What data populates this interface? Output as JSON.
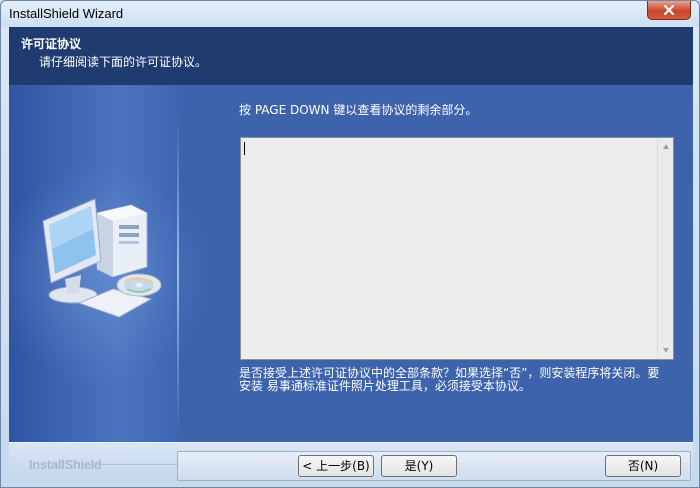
{
  "window": {
    "title": "InstallShield Wizard"
  },
  "header": {
    "title": "许可证协议",
    "subtitle": "请仔细阅读下面的许可证协议。"
  },
  "content": {
    "instruction": "按 PAGE DOWN 键以查看协议的剩余部分。",
    "license_text": "",
    "question_line1": "是否接受上述许可证协议中的全部条款？如果选择“否”，则安装程序将关闭。要",
    "question_line2": "安装 易事通标准证件照片处理工具，必须接受本协议。"
  },
  "footer": {
    "brand": "InstallShield",
    "back_label": "< 上一步(B)",
    "yes_label": "是(Y)",
    "no_label": "否(N)"
  },
  "colors": {
    "header_bg": "#1f3b70",
    "panel_bg": "#3d63ad",
    "close_button": "#c7462b"
  },
  "icons": [
    "close-icon",
    "computer-cd-icon",
    "scroll-up-arrow-icon",
    "scroll-down-arrow-icon"
  ]
}
